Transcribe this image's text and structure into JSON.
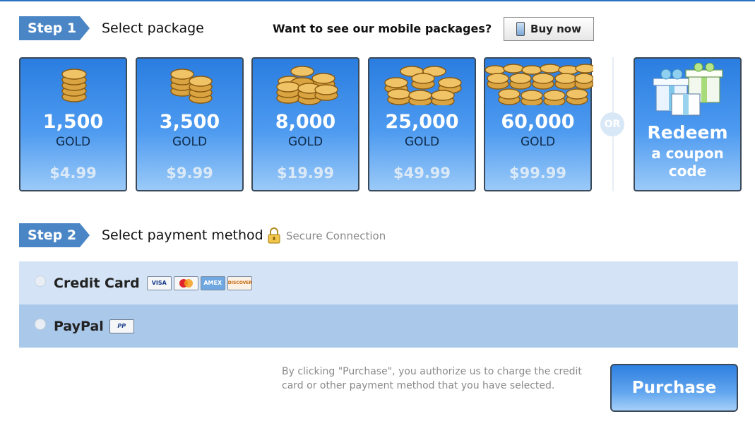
{
  "step1": {
    "badge": "Step 1",
    "label": "Select package",
    "mobile_question": "Want to see our mobile packages?",
    "buy_now_label": "Buy now"
  },
  "packages": [
    {
      "amount": "1,500",
      "unit": "GOLD",
      "price": "$4.99"
    },
    {
      "amount": "3,500",
      "unit": "GOLD",
      "price": "$9.99"
    },
    {
      "amount": "8,000",
      "unit": "GOLD",
      "price": "$19.99"
    },
    {
      "amount": "25,000",
      "unit": "GOLD",
      "price": "$49.99"
    },
    {
      "amount": "60,000",
      "unit": "GOLD",
      "price": "$99.99"
    }
  ],
  "or_label": "OR",
  "redeem": {
    "title": "Redeem",
    "subtitle": "a coupon code"
  },
  "step2": {
    "badge": "Step 2",
    "label": "Select payment method",
    "secure_text": "Secure Connection"
  },
  "payment_methods": {
    "credit_card": {
      "label": "Credit Card",
      "card_logos": [
        "VISA",
        "MC",
        "AMEX",
        "DISCOVER"
      ],
      "selected": false
    },
    "paypal": {
      "label": "PayPal",
      "selected": false
    }
  },
  "legal_text": "By clicking \"Purchase\", you authorize us to charge the credit card or other payment method that you have selected.",
  "purchase_label": "Purchase",
  "colors": {
    "accent_blue": "#2a7de0",
    "step_badge": "#4a86c6",
    "row_credit": "#d4e4f6",
    "row_paypal": "#a9c8ea"
  }
}
